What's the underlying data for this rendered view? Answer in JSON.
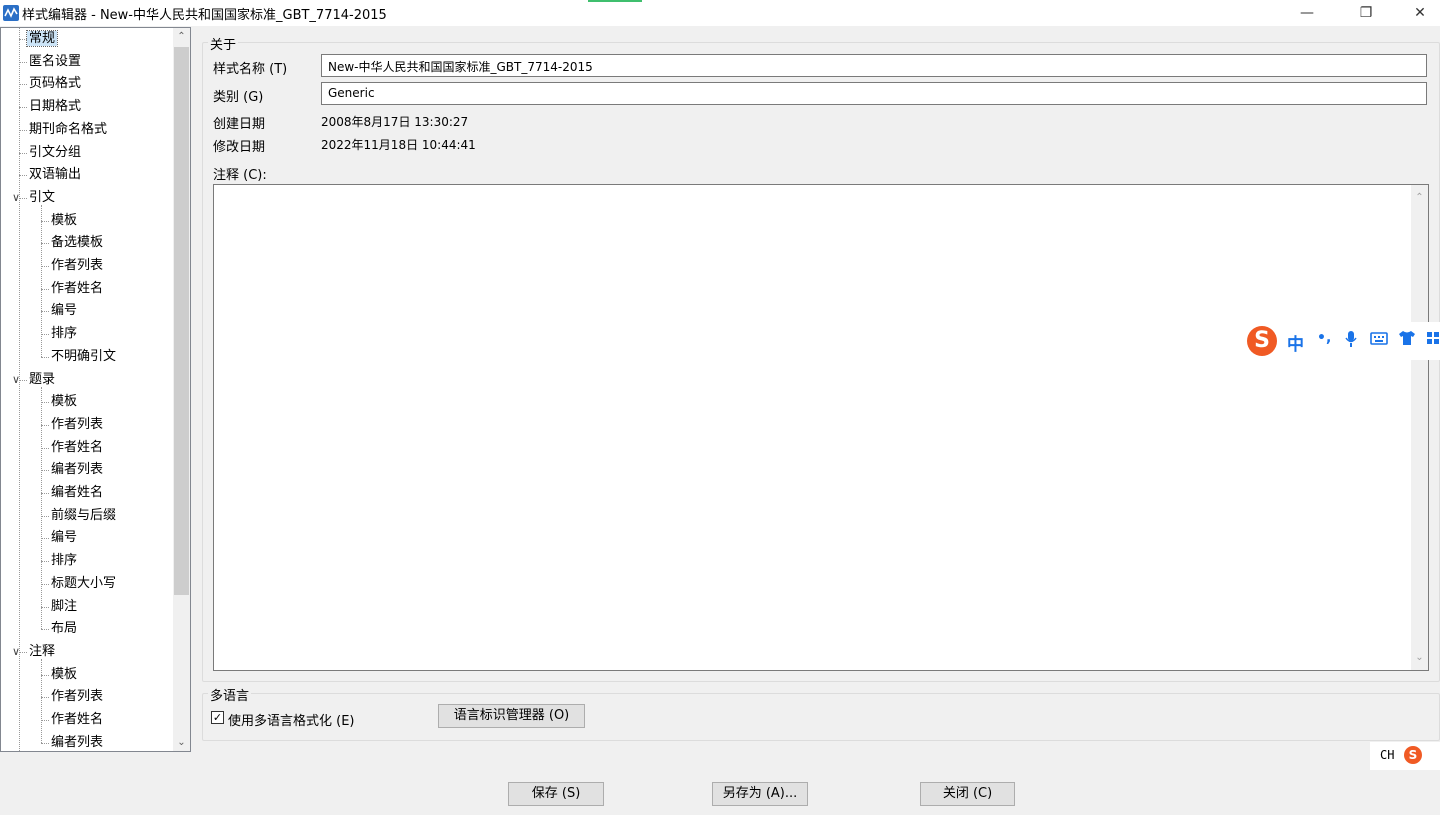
{
  "window": {
    "title": "样式编辑器 - New-中华人民共和国国家标准_GBT_7714-2015",
    "minimize": "—",
    "maximize": "❐",
    "close": "✕"
  },
  "tree": {
    "items": [
      {
        "label": "常规",
        "level": 0,
        "selected": true
      },
      {
        "label": "匿名设置",
        "level": 0
      },
      {
        "label": "页码格式",
        "level": 0
      },
      {
        "label": "日期格式",
        "level": 0
      },
      {
        "label": "期刊命名格式",
        "level": 0
      },
      {
        "label": "引文分组",
        "level": 0
      },
      {
        "label": "双语输出",
        "level": 0
      },
      {
        "label": "引文",
        "level": 0,
        "expanded": true
      },
      {
        "label": "模板",
        "level": 1
      },
      {
        "label": "备选模板",
        "level": 1
      },
      {
        "label": "作者列表",
        "level": 1
      },
      {
        "label": "作者姓名",
        "level": 1
      },
      {
        "label": "编号",
        "level": 1
      },
      {
        "label": "排序",
        "level": 1
      },
      {
        "label": "不明确引文",
        "level": 1
      },
      {
        "label": "题录",
        "level": 0,
        "expanded": true
      },
      {
        "label": "模板",
        "level": 1
      },
      {
        "label": "作者列表",
        "level": 1
      },
      {
        "label": "作者姓名",
        "level": 1
      },
      {
        "label": "编者列表",
        "level": 1
      },
      {
        "label": "编者姓名",
        "level": 1
      },
      {
        "label": "前缀与后缀",
        "level": 1
      },
      {
        "label": "编号",
        "level": 1
      },
      {
        "label": "排序",
        "level": 1
      },
      {
        "label": "标题大小写",
        "level": 1
      },
      {
        "label": "脚注",
        "level": 1
      },
      {
        "label": "布局",
        "level": 1
      },
      {
        "label": "注释",
        "level": 0,
        "expanded": true
      },
      {
        "label": "模板",
        "level": 1
      },
      {
        "label": "作者列表",
        "level": 1
      },
      {
        "label": "作者姓名",
        "level": 1
      },
      {
        "label": "编者列表",
        "level": 1
      }
    ]
  },
  "about": {
    "group_title": "关于",
    "style_name_label": "样式名称 (T)",
    "style_name_value": "New-中华人民共和国国家标准_GBT_7714-2015",
    "category_label": "类别 (G)",
    "category_value": "Generic",
    "created_label": "创建日期",
    "created_value": "2008年8月17日 13:30:27",
    "modified_label": "修改日期",
    "modified_value": "2022年11月18日 10:44:41",
    "notes_label": "注释 (C):"
  },
  "multilang": {
    "group_title": "多语言",
    "checkbox_label": "使用多语言格式化 (E)",
    "checked": true,
    "manager_button": "语言标识管理器 (O)"
  },
  "footer": {
    "save": "保存 (S)",
    "save_as": "另存为 (A)...",
    "close": "关闭 (C)"
  },
  "ime": {
    "logo": "S",
    "mode": "中",
    "punct": "•,",
    "tray_label": "CH"
  }
}
